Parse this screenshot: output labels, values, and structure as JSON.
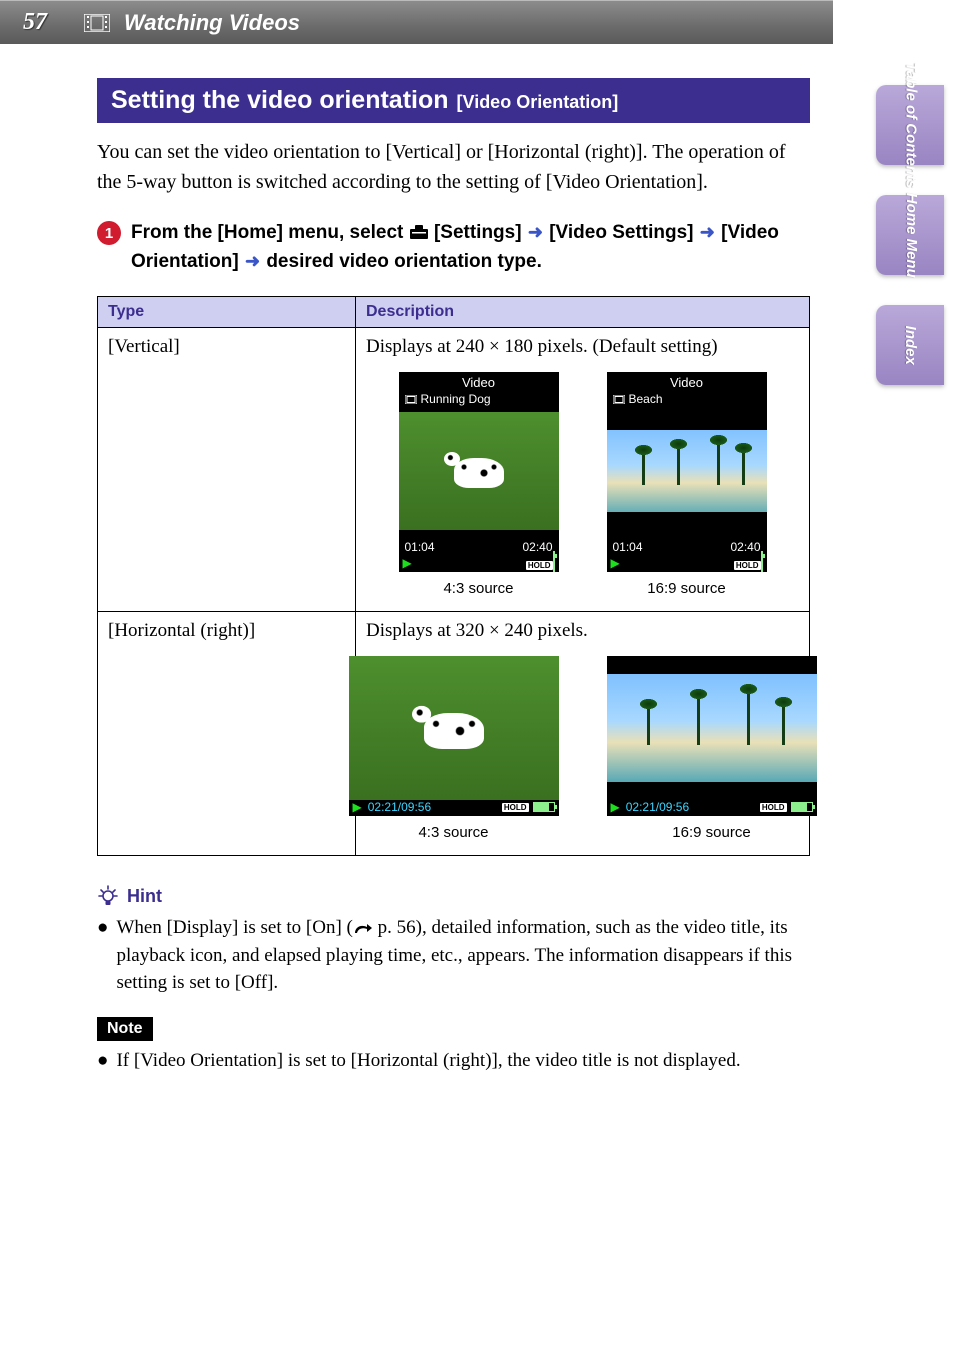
{
  "header": {
    "page_number": "57",
    "section": "Watching Videos"
  },
  "side_tabs": {
    "toc": "Table of\nContents",
    "home": "Home\nMenu",
    "index": "Index"
  },
  "heading": {
    "main": "Setting the video orientation",
    "sub": "[Video Orientation]"
  },
  "intro": "You can set the video orientation to [Vertical] or [Horizontal (right)]. The operation of the 5-way button is switched according to the setting of [Video Orientation].",
  "step": {
    "number": "1",
    "pre": "From the [Home] menu, select ",
    "settings": " [Settings] ",
    "video_settings": " [Video Settings] ",
    "video_orientation": " [Video Orientation] ",
    "tail": " desired video orientation type."
  },
  "table": {
    "headers": {
      "type": "Type",
      "desc": "Description"
    },
    "rows": [
      {
        "type": "[Vertical]",
        "desc": "Displays at 240 × 180 pixels. (Default setting)",
        "screens": [
          {
            "title": "Video",
            "subtitle": "Running Dog",
            "t1": "01:04",
            "t2": "02:40",
            "caption": "4:3 source"
          },
          {
            "title": "Video",
            "subtitle": "Beach",
            "t1": "01:04",
            "t2": "02:40",
            "caption": "16:9 source"
          }
        ]
      },
      {
        "type": "[Horizontal (right)]",
        "desc": "Displays at 320 × 240 pixels.",
        "screens": [
          {
            "time": "02:21/09:56",
            "caption": "4:3 source"
          },
          {
            "time": "02:21/09:56",
            "caption": "16:9 source"
          }
        ]
      }
    ]
  },
  "hint": {
    "label": "Hint",
    "text_a": "When [Display] is set to [On] (",
    "pageref": " p. 56",
    "text_b": "), detailed information, such as the video title, its playback icon, and elapsed playing time, etc., appears. The information disappears if this setting is set to [Off]."
  },
  "note": {
    "label": "Note",
    "text": "If [Video Orientation] is set to [Horizontal (right)], the video title is not displayed."
  },
  "status_badge": "HOLD"
}
